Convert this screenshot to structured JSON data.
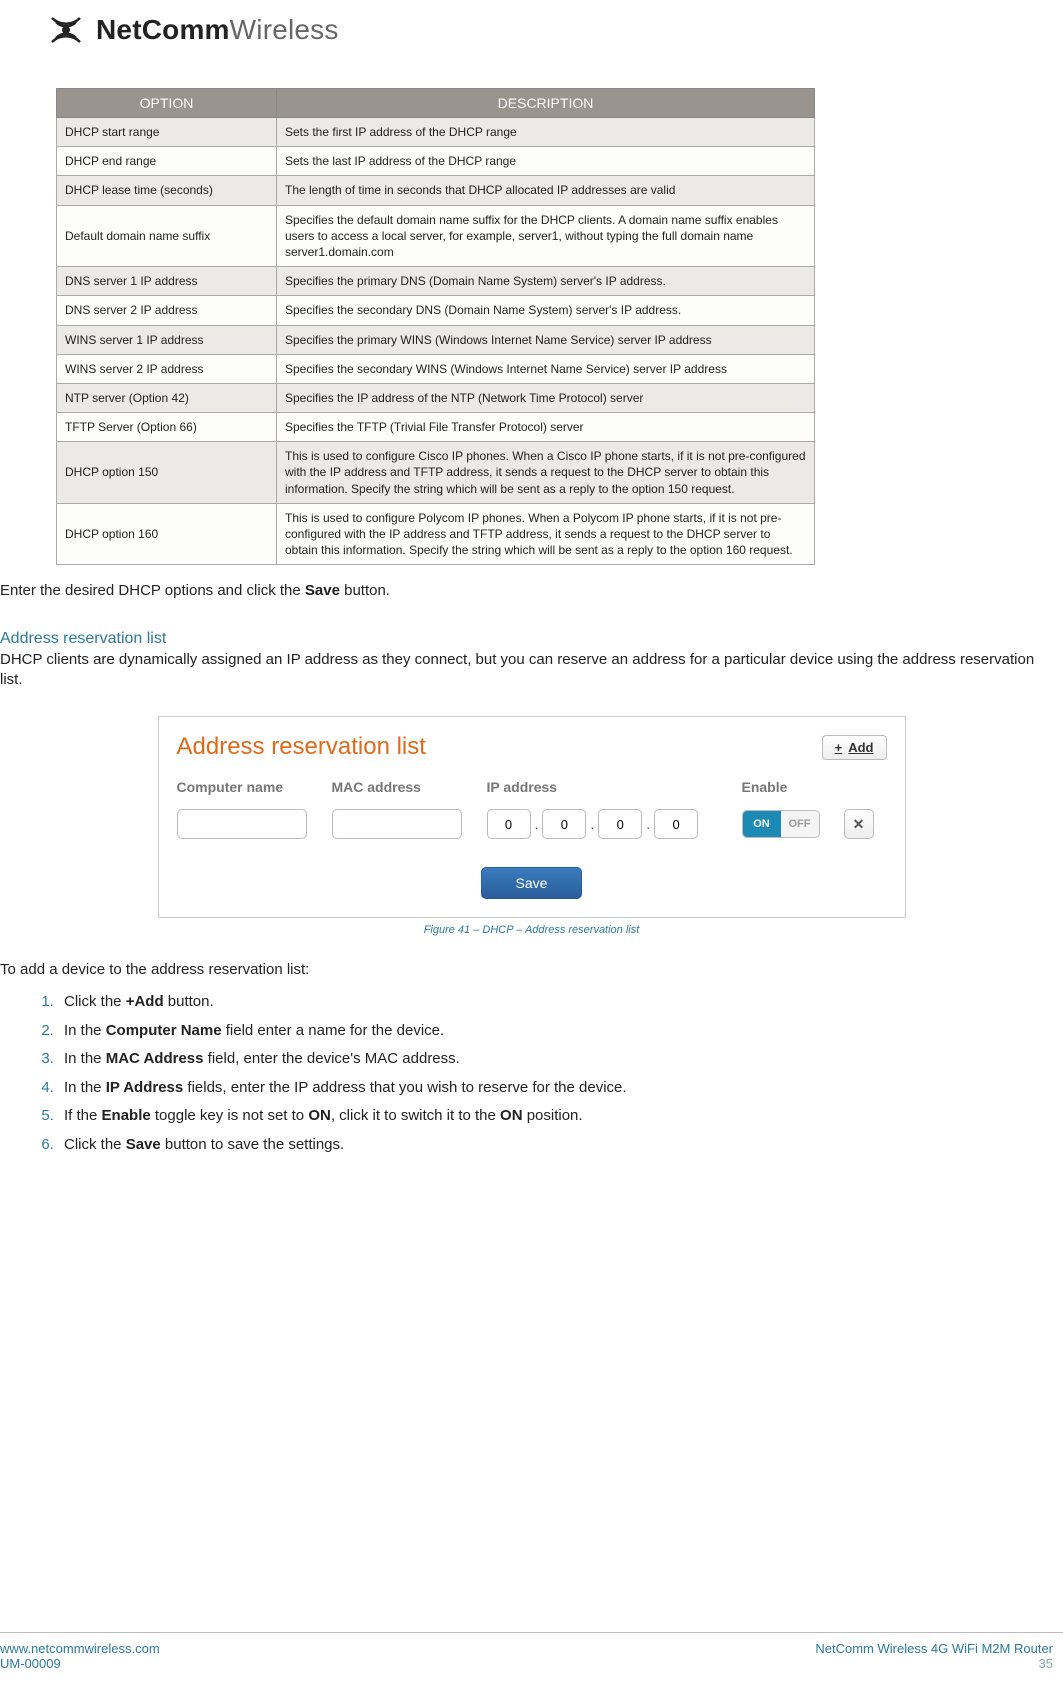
{
  "brand": {
    "bold": "NetComm",
    "light": "Wireless"
  },
  "table": {
    "headers": [
      "OPTION",
      "DESCRIPTION"
    ],
    "rows": [
      {
        "opt": "DHCP start range",
        "desc": "Sets the first IP address of the DHCP range"
      },
      {
        "opt": "DHCP end range",
        "desc": "Sets the last IP address of the DHCP range"
      },
      {
        "opt": "DHCP lease time (seconds)",
        "desc": "The length of time in seconds that DHCP allocated IP addresses are valid"
      },
      {
        "opt": "Default domain name suffix",
        "desc": "Specifies the default domain name suffix for the DHCP clients. A domain name suffix enables users to access a local server, for example, server1, without typing the full domain name server1.domain.com"
      },
      {
        "opt": "DNS server 1 IP address",
        "desc": "Specifies the primary DNS (Domain Name System) server's IP address."
      },
      {
        "opt": "DNS server 2 IP address",
        "desc": "Specifies the secondary DNS (Domain Name System) server's IP address."
      },
      {
        "opt": "WINS server 1 IP address",
        "desc": "Specifies the primary WINS (Windows Internet Name Service) server IP address"
      },
      {
        "opt": "WINS server 2 IP address",
        "desc": "Specifies the secondary WINS (Windows Internet Name Service) server IP address"
      },
      {
        "opt": "NTP server (Option 42)",
        "desc": "Specifies the IP address of the NTP (Network Time Protocol) server"
      },
      {
        "opt": "TFTP Server (Option 66)",
        "desc": "Specifies the TFTP (Trivial File Transfer Protocol) server"
      },
      {
        "opt": "DHCP option 150",
        "desc": "This is used to configure Cisco IP phones. When a Cisco IP phone starts, if it is not pre-configured with the IP address and TFTP address, it sends a request to the DHCP server to obtain this information. Specify the string which will be sent as a reply to the option 150 request."
      },
      {
        "opt": "DHCP option 160",
        "desc": "This is used to configure Polycom IP phones. When a Polycom IP phone starts, if it is not pre-configured with the IP address and TFTP address, it sends a request to the DHCP server to obtain this information. Specify the string which will be sent as a reply to the option 160 request."
      }
    ]
  },
  "para1_pre": "Enter the desired DHCP options and click the ",
  "para1_bold": "Save",
  "para1_post": " button.",
  "section_heading": "Address reservation list",
  "para2": "DHCP clients are dynamically assigned an IP address as they connect, but you can reserve an address for a particular device using the address reservation list.",
  "ui": {
    "title": "Address reservation list",
    "add_label": "Add",
    "cols": [
      "Computer name",
      "MAC address",
      "IP address",
      "Enable"
    ],
    "ip": [
      "0",
      "0",
      "0",
      "0"
    ],
    "toggle_on": "ON",
    "toggle_off": "OFF",
    "save": "Save"
  },
  "caption": "Figure 41 – DHCP – Address reservation list",
  "steps_intro": "To add a device to the address reservation list:",
  "steps": [
    {
      "pre": "Click the ",
      "b": "+Add",
      "post": " button."
    },
    {
      "pre": "In the ",
      "b": "Computer Name",
      "post": " field enter a name for the device."
    },
    {
      "pre": "In the ",
      "b": "MAC Address",
      "post": " field, enter the device's MAC address."
    },
    {
      "pre": "In the ",
      "b": "IP Address",
      "post": " fields, enter the IP address that you wish to reserve for the device."
    },
    {
      "pre": "If the ",
      "b": "Enable",
      "post": " toggle key is not set to ",
      "b2": "ON",
      "post2": ", click it to switch it to the ",
      "b3": "ON",
      "post3": " position."
    },
    {
      "pre": "Click the ",
      "b": "Save",
      "post": " button to save the settings."
    }
  ],
  "footer": {
    "url": "www.netcommwireless.com",
    "code": "UM-00009",
    "product": "NetComm Wireless 4G WiFi M2M Router",
    "page": "35"
  }
}
